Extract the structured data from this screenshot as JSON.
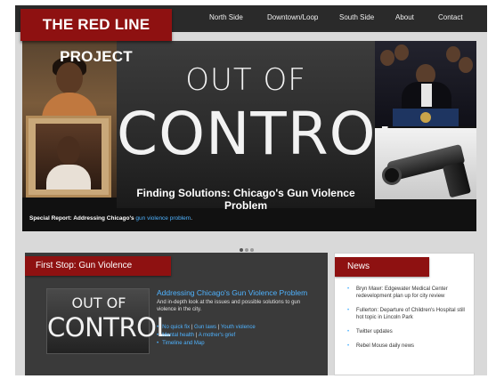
{
  "site": {
    "logo": "THE RED LINE PROJECT"
  },
  "nav": {
    "items": [
      "North Side",
      "Downtown/Loop",
      "South Side",
      "About",
      "Contact"
    ]
  },
  "hero": {
    "line1": "OUT OF",
    "line2": "CONTROL",
    "subtitle": "Finding Solutions: Chicago's Gun Violence Problem",
    "special_label": "Special Report: Addressing Chicago's",
    "special_link": "gun violence problem",
    "special_end": "."
  },
  "slider": {
    "count": 3,
    "active_index": 0
  },
  "first_stop": {
    "header": "First Stop: Gun Violence",
    "thumb_line1": "OUT OF",
    "thumb_line2": "CONTROL",
    "title": "Addressing Chicago's Gun Violence Problem",
    "description": "And in-depth look at the issues and possible solutions to gun violence in the city.",
    "links": [
      {
        "a": "No quick fix",
        "sep": " | ",
        "b": "Gun laws",
        "sep2": " | ",
        "c": "Youth violence"
      },
      {
        "a": "Mental health",
        "sep": " | ",
        "b": "A mother's grief",
        "sep2": "",
        "c": ""
      },
      {
        "a": "Timeline and Map",
        "sep": "",
        "b": "",
        "sep2": "",
        "c": ""
      }
    ]
  },
  "news": {
    "header": "News",
    "items": [
      "Bryn Mawr: Edgewater Medical Center redevelopment plan up for city review",
      "Fullerton: Departure of Children's Hospital still hot topic in Lincoln Park",
      "Twitter updates",
      "Rebel Mouse daily news"
    ]
  },
  "colors": {
    "accent_red": "#8e1111",
    "link_blue": "#4fb3ff",
    "nav_dark": "#2a2a2a"
  }
}
